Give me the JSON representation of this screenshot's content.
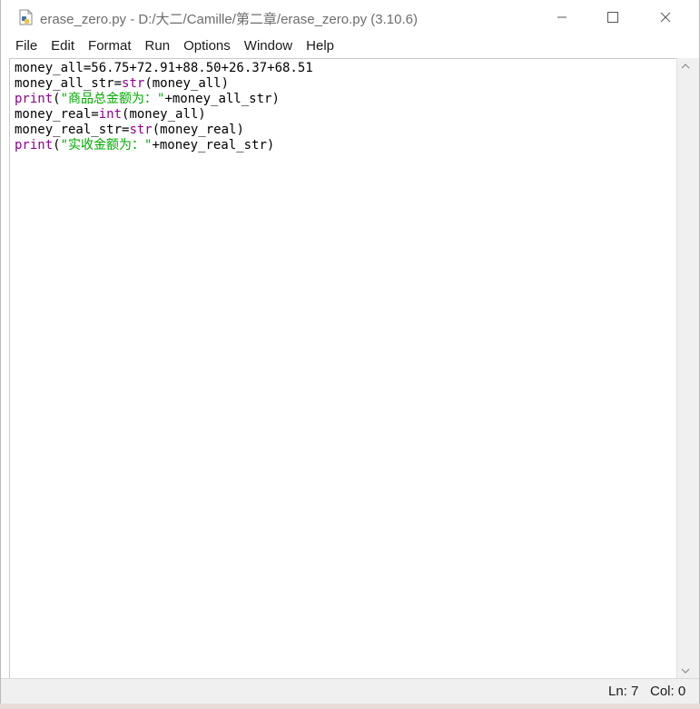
{
  "window": {
    "title": "erase_zero.py - D:/大二/Camille/第二章/erase_zero.py (3.10.6)",
    "controls": {
      "minimize": "minimize-icon",
      "maximize": "maximize-icon",
      "close": "close-icon"
    }
  },
  "menu": [
    "File",
    "Edit",
    "Format",
    "Run",
    "Options",
    "Window",
    "Help"
  ],
  "editor": {
    "lines": [
      [
        {
          "t": "money_all=56.75+72.91+88.50+26.37+68.51",
          "k": "plain"
        }
      ],
      [
        {
          "t": "money_all_str=",
          "k": "plain"
        },
        {
          "t": "str",
          "k": "builtin"
        },
        {
          "t": "(money_all)",
          "k": "plain"
        }
      ],
      [
        {
          "t": "print",
          "k": "builtin"
        },
        {
          "t": "(",
          "k": "plain"
        },
        {
          "t": "\"商品总金额为：\"",
          "k": "string"
        },
        {
          "t": "+money_all_str)",
          "k": "plain"
        }
      ],
      [
        {
          "t": "money_real=",
          "k": "plain"
        },
        {
          "t": "int",
          "k": "builtin"
        },
        {
          "t": "(money_all)",
          "k": "plain"
        }
      ],
      [
        {
          "t": "money_real_str=",
          "k": "plain"
        },
        {
          "t": "str",
          "k": "builtin"
        },
        {
          "t": "(money_real)",
          "k": "plain"
        }
      ],
      [
        {
          "t": "print",
          "k": "builtin"
        },
        {
          "t": "(",
          "k": "plain"
        },
        {
          "t": "\"实收金额为：\"",
          "k": "string"
        },
        {
          "t": "+money_real_str)",
          "k": "plain"
        }
      ]
    ]
  },
  "status": {
    "ln": "Ln: 7",
    "col": "Col: 0"
  },
  "colors": {
    "builtin": "#900090",
    "string": "#00aa00",
    "text": "#000000"
  }
}
